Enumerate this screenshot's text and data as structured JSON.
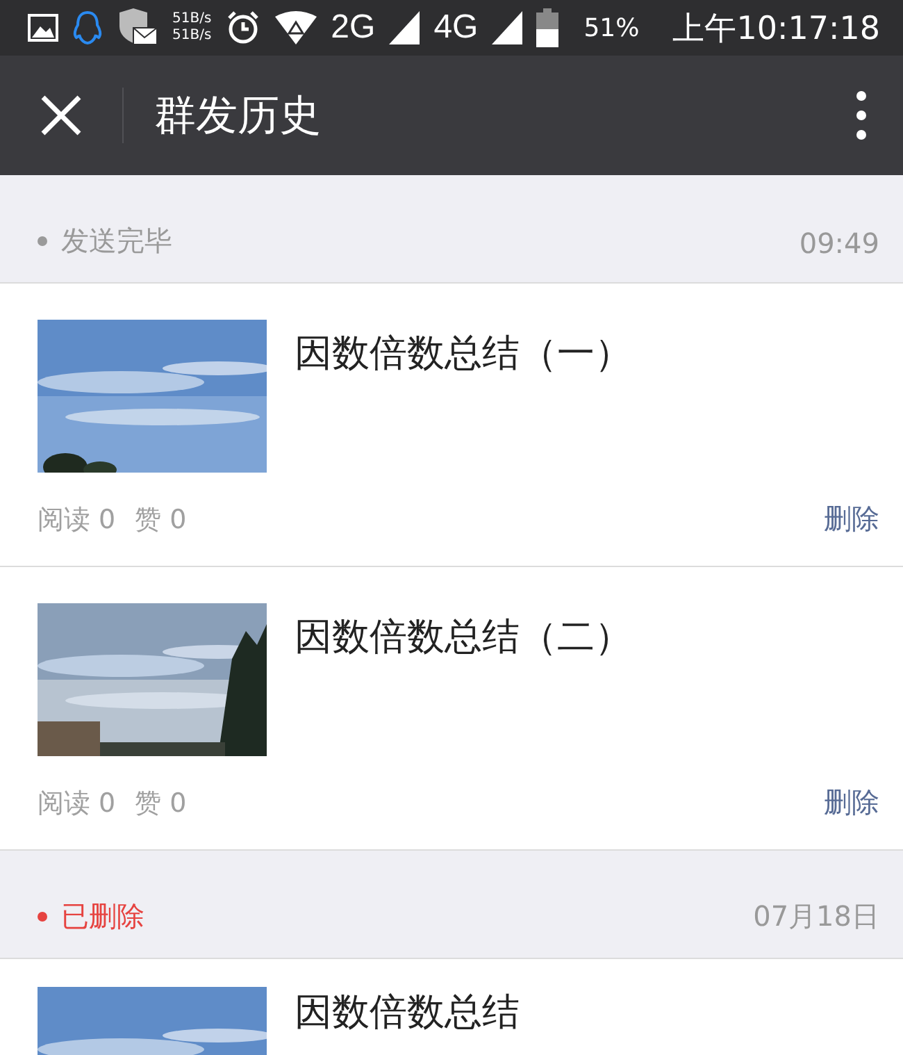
{
  "status_bar": {
    "speed_up": "51B/s",
    "speed_down": "51B/s",
    "network_1": "2G",
    "network_2": "4G",
    "battery": "51%",
    "time": "上午10:17:18"
  },
  "toolbar": {
    "title": "群发历史"
  },
  "groups": [
    {
      "color": "#9a9a9a",
      "label": "发送完毕",
      "time": "09:49",
      "items": [
        {
          "title": "因数倍数总结（一）",
          "reads": "阅读 0",
          "likes": "赞 0",
          "action": "删除"
        },
        {
          "title": "因数倍数总结（二）",
          "reads": "阅读 0",
          "likes": "赞 0",
          "action": "删除"
        }
      ]
    },
    {
      "color": "#e64340",
      "label": "已删除",
      "time": "07月18日",
      "items": [
        {
          "title": "因数倍数总结"
        }
      ]
    }
  ]
}
